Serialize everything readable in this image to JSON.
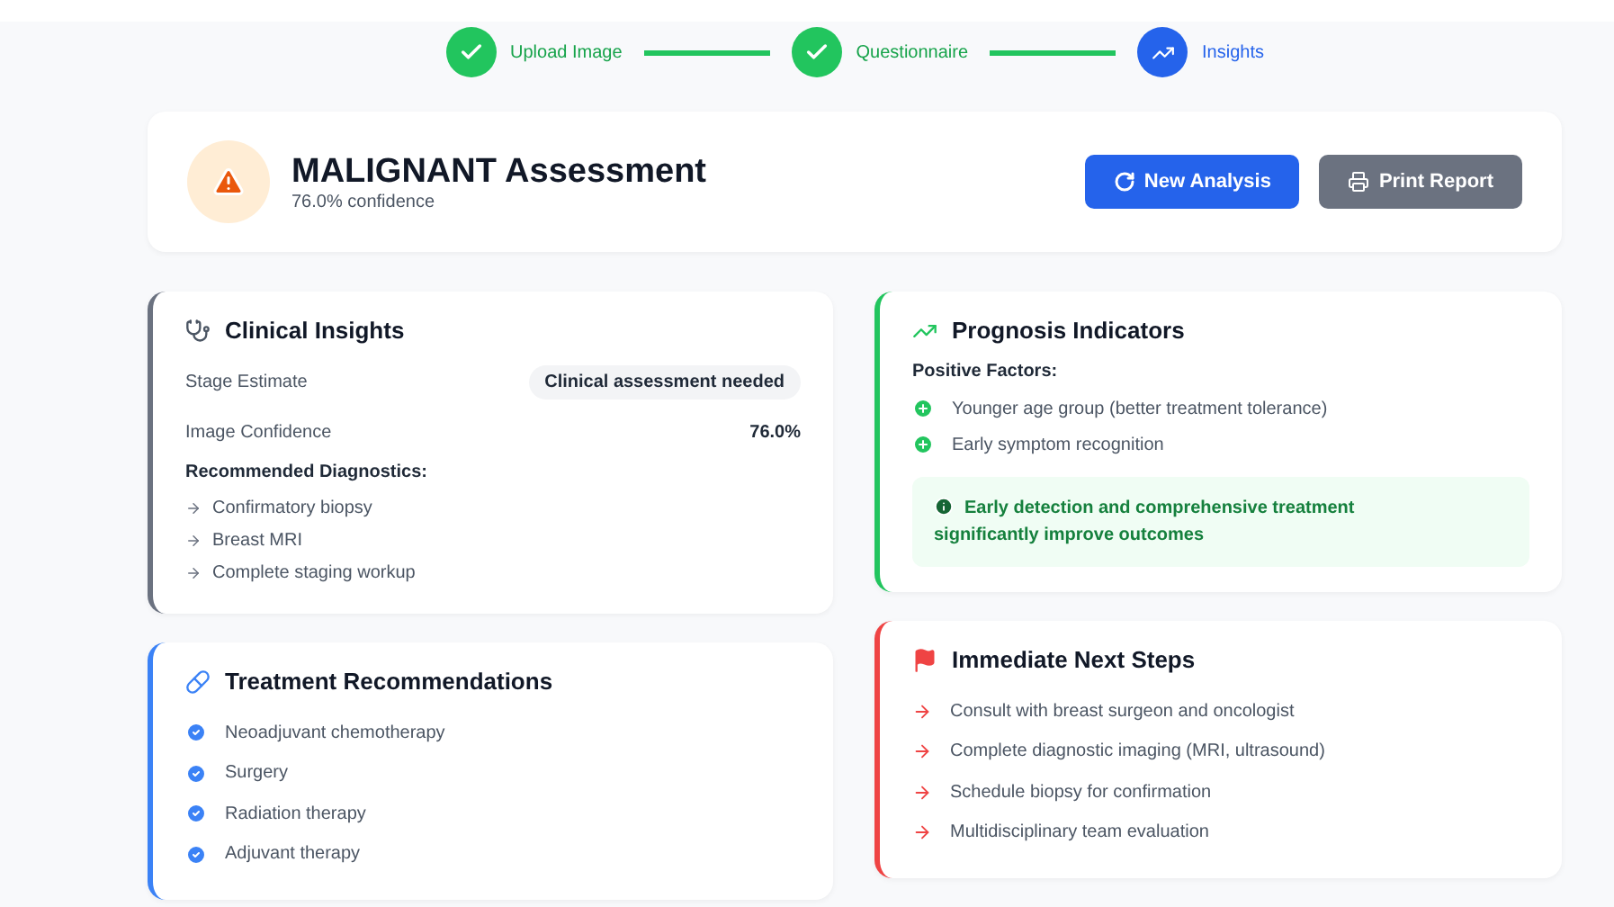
{
  "steps": [
    {
      "label": "Upload Image",
      "completed": true
    },
    {
      "label": "Questionnaire",
      "completed": true
    },
    {
      "label": "Insights",
      "completed": false
    }
  ],
  "header": {
    "title": "MALIGNANT Assessment",
    "subtitle": "76.0% confidence",
    "buttons": [
      {
        "label": "New Analysis",
        "kind": "primary"
      },
      {
        "label": "Print Report",
        "kind": "secondary"
      }
    ]
  },
  "columns": [
    [
      {
        "kind": "details",
        "title": "Clinical Insights",
        "color": "#6b7280",
        "rows": [
          {
            "label": "Stage Estimate",
            "value": "Clinical assessment needed",
            "kind": "pill"
          },
          {
            "label": "Image Confidence",
            "value": "76.0%",
            "kind": "plain"
          }
        ],
        "subheading": "Recommended Diagnostics:",
        "items": [
          "Confirmatory biopsy",
          "Breast MRI",
          "Complete staging workup"
        ]
      },
      {
        "kind": "checklist",
        "title": "Treatment Recommendations",
        "color": "#3b82f6",
        "items": [
          "Neoadjuvant chemotherapy",
          "Surgery",
          "Radiation therapy",
          "Adjuvant therapy"
        ]
      }
    ],
    [
      {
        "kind": "factors",
        "title": "Prognosis Indicators",
        "color": "#22c55e",
        "subheading": "Positive Factors:",
        "items": [
          "Younger age group (better treatment tolerance)",
          "Early symptom recognition"
        ],
        "note": "Early detection and comprehensive treatment significantly improve outcomes"
      },
      {
        "kind": "steps",
        "title": "Immediate Next Steps",
        "color": "#ef4444",
        "items": [
          "Consult with breast surgeon and oncologist",
          "Complete diagnostic imaging (MRI, ultrasound)",
          "Schedule biopsy for confirmation",
          "Multidisciplinary team evaluation"
        ]
      }
    ]
  ]
}
